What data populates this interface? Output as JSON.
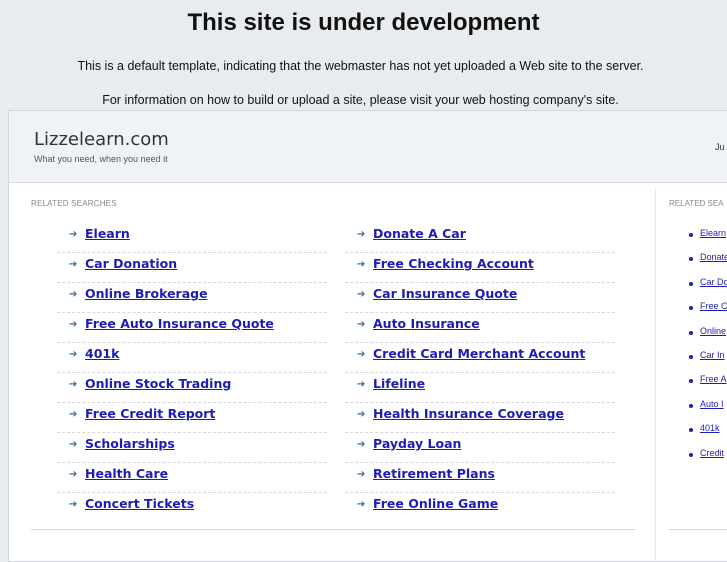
{
  "notice": {
    "title": "This site is under development",
    "line1": "This is a default template, indicating that the webmaster has not yet uploaded a Web site to the server.",
    "line2": "For information on how to build or upload a site, please visit your web hosting company's site."
  },
  "site": {
    "name": "Lizzelearn.com",
    "tagline": "What you need, when you need it",
    "date_partial": "Ju"
  },
  "main": {
    "section_title": "RELATED SEARCHES",
    "left_links": [
      "Elearn",
      "Car Donation",
      "Online Brokerage",
      "Free Auto Insurance Quote",
      "401k",
      "Online Stock Trading",
      "Free Credit Report",
      "Scholarships",
      "Health Care",
      "Concert Tickets"
    ],
    "right_links": [
      "Donate A Car",
      "Free Checking Account",
      "Car Insurance Quote",
      "Auto Insurance",
      "Credit Card Merchant Account",
      "Lifeline",
      "Health Insurance Coverage",
      "Payday Loan",
      "Retirement Plans",
      "Free Online Game"
    ]
  },
  "sidebar": {
    "section_title": "RELATED SEA",
    "links": [
      "Elearn",
      "Donate",
      "Car Do",
      "Free C",
      "Online",
      "Car In",
      "Free A",
      "Auto I",
      "401k",
      "Credit"
    ]
  },
  "colors": {
    "link": "#1d1db5",
    "arrow": "#3a6aa0",
    "background": "#e9ecee"
  },
  "icons": {
    "link_marker": "arrow-right-icon",
    "sidebar_marker": "bullet-icon"
  }
}
